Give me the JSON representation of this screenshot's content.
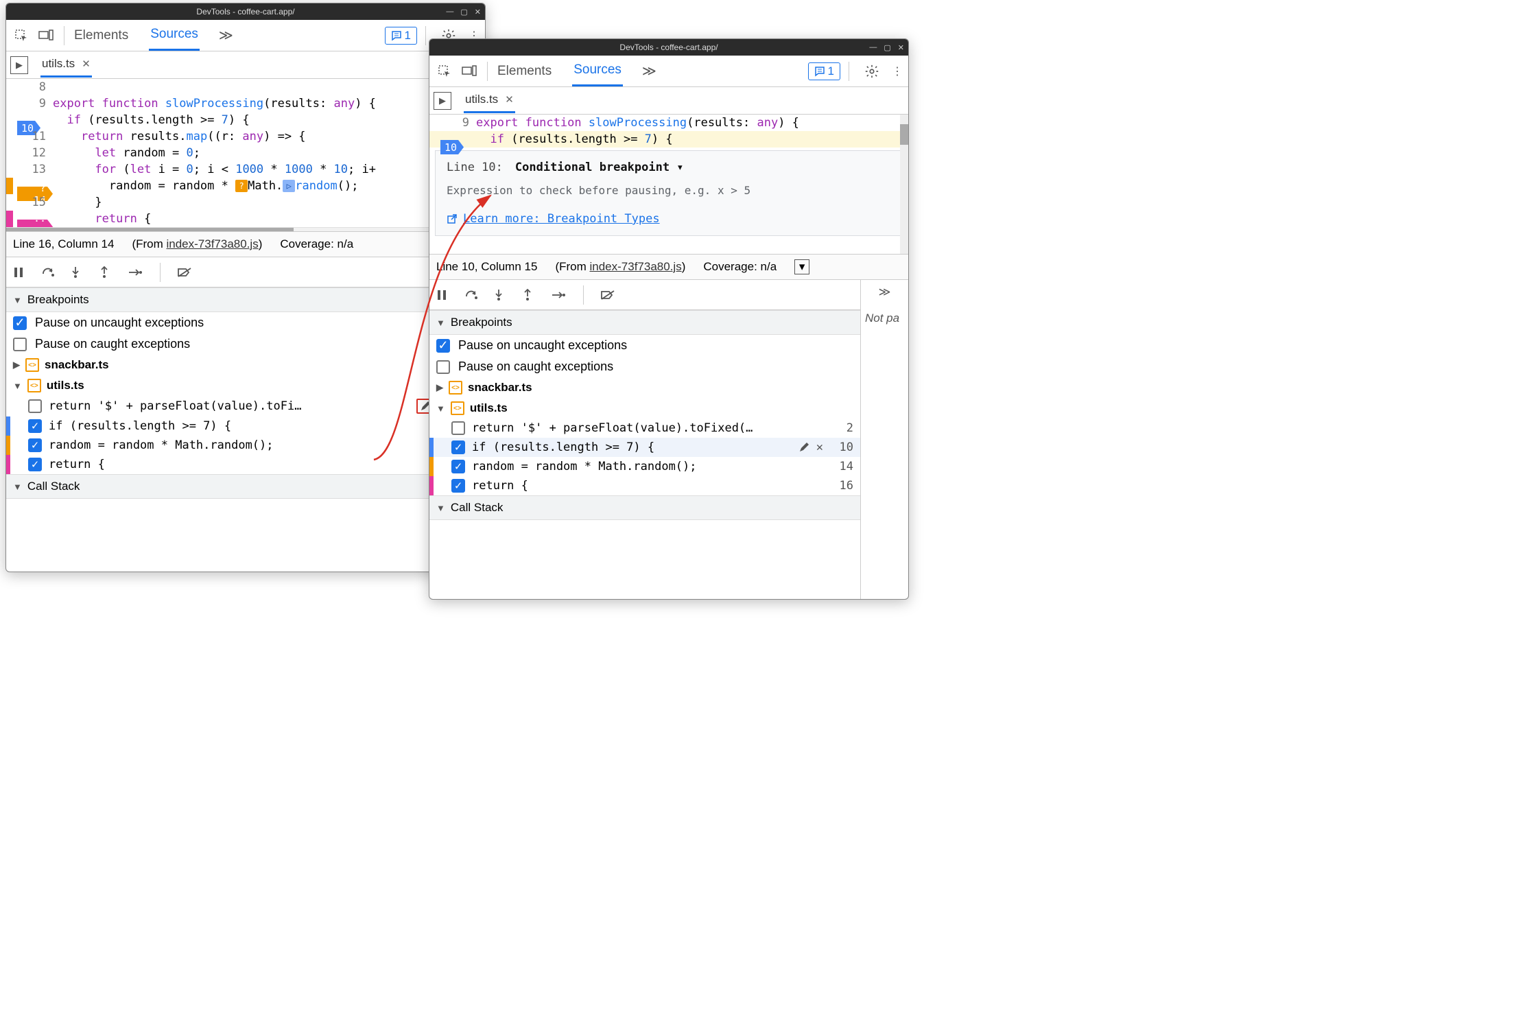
{
  "window_title": "DevTools - coffee-cart.app/",
  "toolbar": {
    "tabs": [
      "Elements",
      "Sources"
    ],
    "active_tab": "Sources",
    "issue_count": "1"
  },
  "file_tab": "utils.ts",
  "code1": {
    "lines": [
      {
        "n": "8",
        "txt": ""
      },
      {
        "n": "9",
        "txt": "export function slowProcessing(results: any) {"
      },
      {
        "n": "10",
        "txt": "  if (results.length >= 7) {",
        "bp": "blue"
      },
      {
        "n": "11",
        "txt": "    return results.map((r: any) => {"
      },
      {
        "n": "12",
        "txt": "      let random = 0;"
      },
      {
        "n": "13",
        "txt": "      for (let i = 0; i < 1000 * 1000 * 10; i+"
      },
      {
        "n": "14",
        "txt": "        random = random * Math.random();",
        "bp": "orange",
        "bp_prefix": "?",
        "inline_icons": true
      },
      {
        "n": "15",
        "txt": "      }"
      },
      {
        "n": "16",
        "txt": "      return {",
        "bp": "pink",
        "bp_prefix": "··"
      }
    ]
  },
  "status1": {
    "pos": "Line 16, Column 14",
    "from": "index-73f73a80.js",
    "coverage": "Coverage: n/a"
  },
  "status2": {
    "pos": "Line 10, Column 15",
    "from": "index-73f73a80.js",
    "coverage": "Coverage: n/a"
  },
  "breakpoints_header": "Breakpoints",
  "pause_uncaught": "Pause on uncaught exceptions",
  "pause_caught": "Pause on caught exceptions",
  "bp_files": {
    "snackbar": "snackbar.ts",
    "utils": "utils.ts"
  },
  "bp_entries": [
    {
      "code": "return '$' + parseFloat(value).toFi…",
      "line": "2",
      "checked": false,
      "tag": ""
    },
    {
      "code": "if (results.length >= 7) {",
      "line": "10",
      "checked": true,
      "tag": "blue"
    },
    {
      "code": "random = random * Math.random();",
      "line": "14",
      "checked": true,
      "tag": "orange"
    },
    {
      "code": "return {",
      "line": "16",
      "checked": true,
      "tag": "pink"
    }
  ],
  "bp_entries2": [
    {
      "code": "return '$' + parseFloat(value).toFixed(…",
      "line": "2",
      "checked": false,
      "tag": ""
    },
    {
      "code": "if (results.length >= 7) {",
      "line": "10",
      "checked": true,
      "tag": "blue",
      "show_actions": true
    },
    {
      "code": "random = random * Math.random();",
      "line": "14",
      "checked": true,
      "tag": "orange"
    },
    {
      "code": "return {",
      "line": "16",
      "checked": true,
      "tag": "pink"
    }
  ],
  "callstack_header": "Call Stack",
  "code2_header": {
    "n9": "9",
    "n10": "10"
  },
  "popover": {
    "line_label": "Line 10:",
    "type": "Conditional breakpoint ▾",
    "placeholder": "Expression to check before pausing, e.g. x > 5",
    "learn": "Learn more: Breakpoint Types"
  },
  "right_panel_text": "Not pa",
  "right_panel_more": "≫"
}
